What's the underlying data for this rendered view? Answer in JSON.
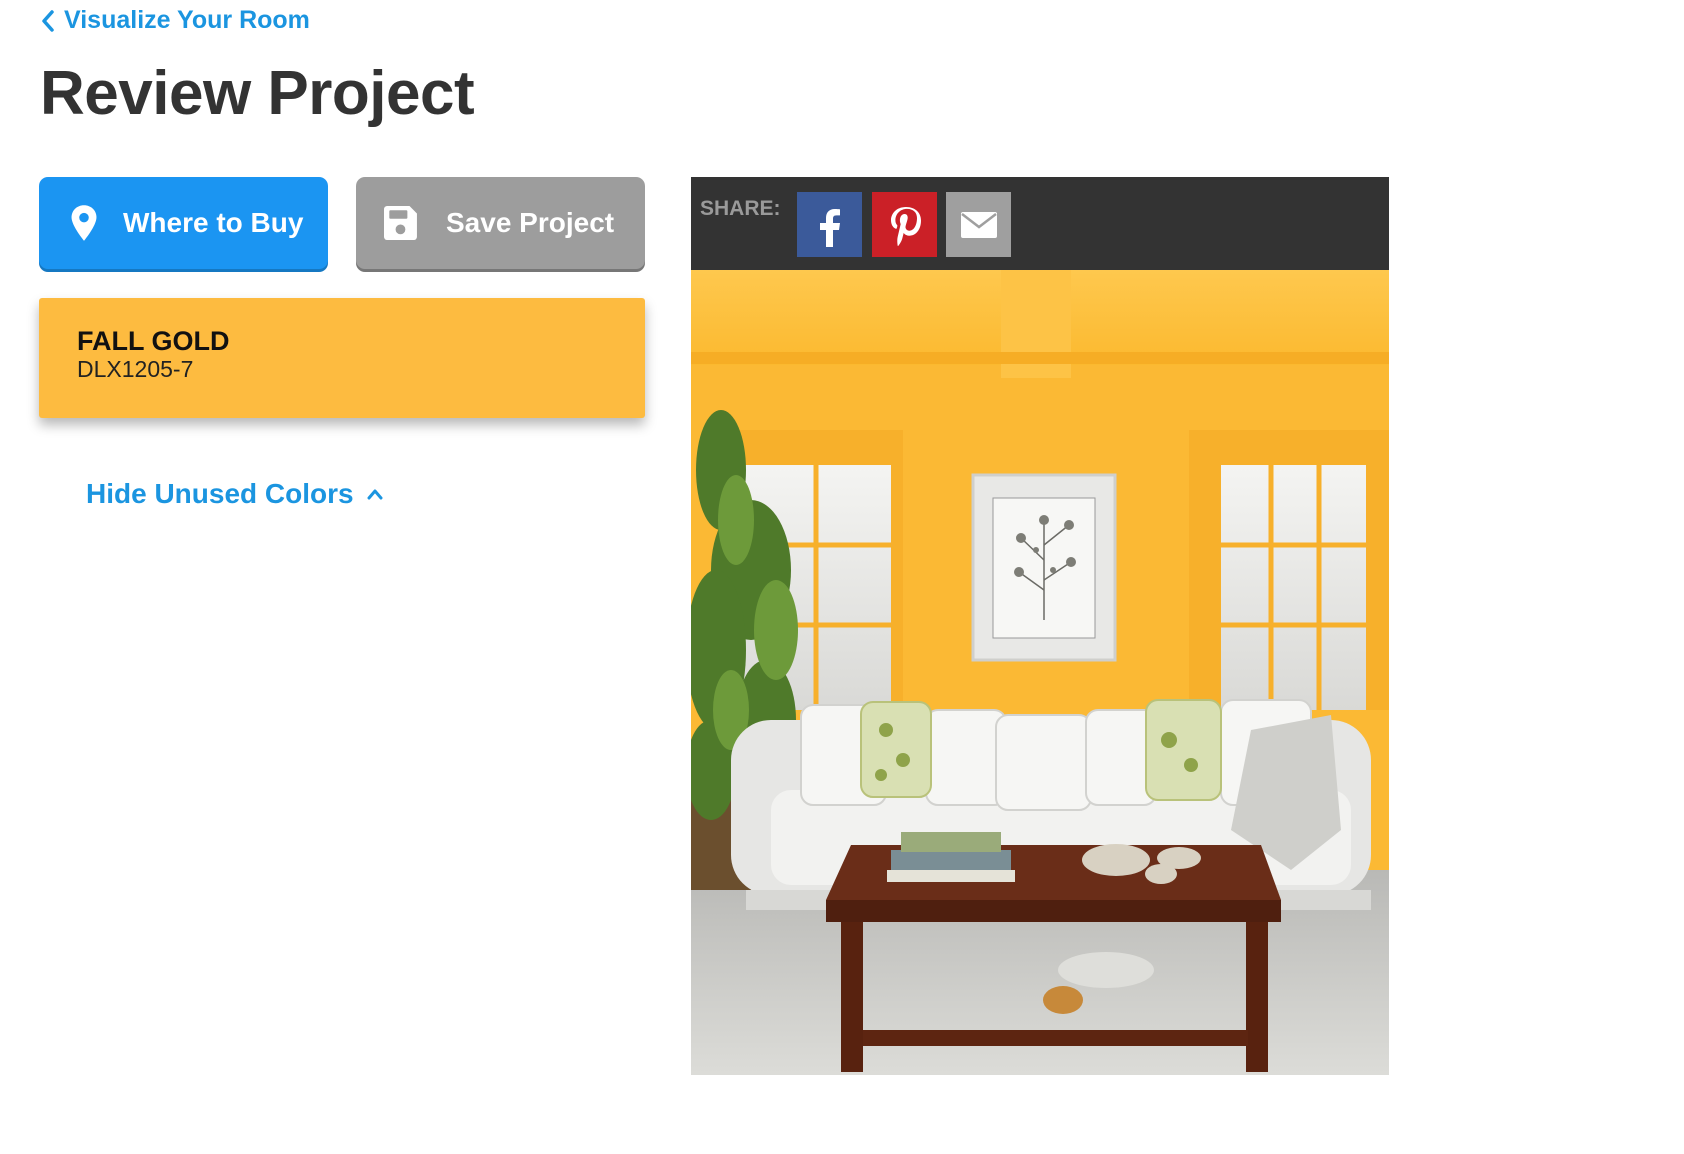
{
  "nav": {
    "back_label": "Visualize Your Room"
  },
  "page": {
    "title": "Review Project"
  },
  "actions": {
    "where_to_buy_label": "Where to Buy",
    "save_project_label": "Save Project"
  },
  "colors": {
    "items": [
      {
        "name": "FALL GOLD",
        "code": "DLX1205-7",
        "swatch": "#fdbb40"
      }
    ],
    "hide_unused_label": "Hide Unused Colors"
  },
  "share": {
    "label": "SHARE:",
    "buttons": [
      {
        "network": "facebook",
        "icon": "facebook-icon",
        "color": "#3b5a9a"
      },
      {
        "network": "pinterest",
        "icon": "pinterest-icon",
        "color": "#cb2027"
      },
      {
        "network": "email",
        "icon": "email-icon",
        "color": "#9f9f9f"
      }
    ]
  },
  "theme": {
    "accent": "#1b95f2",
    "link": "#1b95e0",
    "wall_color": "#fdbb40"
  }
}
